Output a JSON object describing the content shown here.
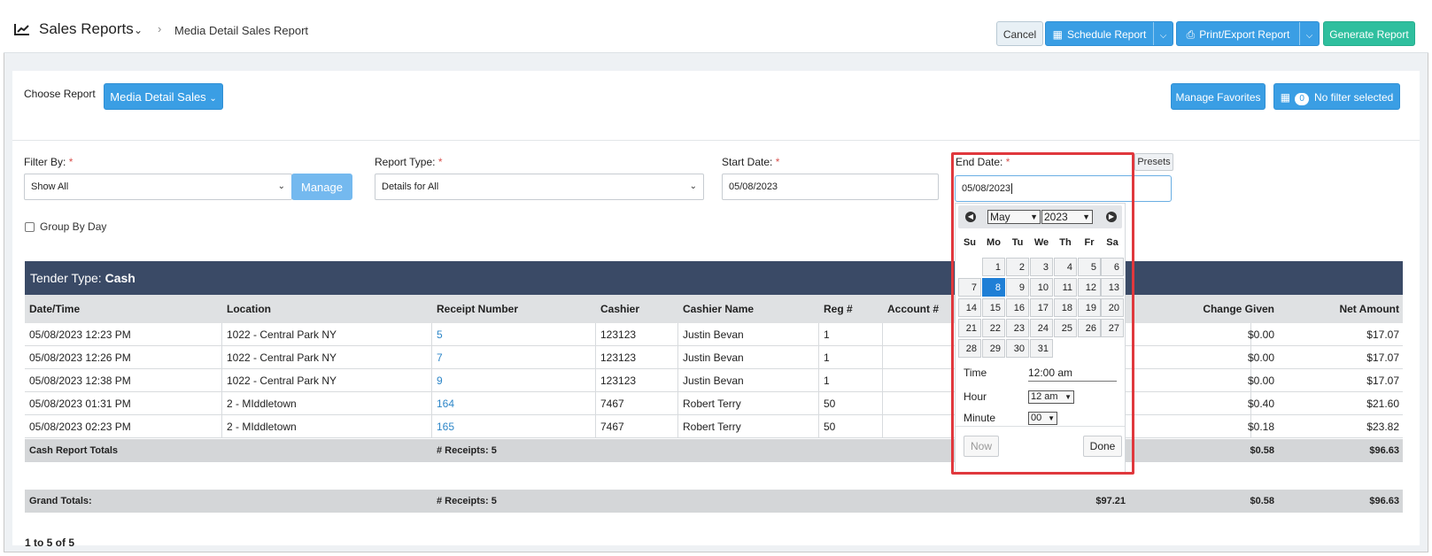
{
  "header": {
    "title": "Sales Reports",
    "breadcrumb": "Media Detail Sales Report",
    "cancel_label": "Cancel",
    "schedule_label": "Schedule Report",
    "print_label": "Print/Export Report",
    "generate_label": "Generate Report"
  },
  "report": {
    "choose_label": "Choose Report",
    "selected_report": "Media Detail Sales",
    "manage_favorites_label": "Manage Favorites",
    "filter_count": "0",
    "filter_status": "No filter selected"
  },
  "filters": {
    "filter_by_label": "Filter By:",
    "filter_by_value": "Show All",
    "manage_label": "Manage",
    "report_type_label": "Report Type:",
    "report_type_value": "Details for All",
    "start_date_label": "Start Date:",
    "start_date_value": "05/08/2023",
    "end_date_label": "End Date:",
    "end_date_value": "05/08/2023",
    "presets_label": "Presets",
    "required_marker": "*",
    "group_by_day_label": "Group By Day"
  },
  "table": {
    "tender_label": "Tender Type:",
    "tender_value": "Cash",
    "columns": {
      "datetime": "Date/Time",
      "location": "Location",
      "receipt": "Receipt Number",
      "cashier": "Cashier",
      "cashier_name": "Cashier Name",
      "reg": "Reg #",
      "account": "Account #",
      "change": "Change Given",
      "net": "Net Amount"
    },
    "rows": [
      {
        "datetime": "05/08/2023 12:23 PM",
        "location": "1022 - Central Park NY",
        "receipt": "5",
        "cashier": "123123",
        "cashier_name": "Justin Bevan",
        "reg": "1",
        "change": "$0.00",
        "net": "$17.07"
      },
      {
        "datetime": "05/08/2023 12:26 PM",
        "location": "1022 - Central Park NY",
        "receipt": "7",
        "cashier": "123123",
        "cashier_name": "Justin Bevan",
        "reg": "1",
        "change": "$0.00",
        "net": "$17.07"
      },
      {
        "datetime": "05/08/2023 12:38 PM",
        "location": "1022 - Central Park NY",
        "receipt": "9",
        "cashier": "123123",
        "cashier_name": "Justin Bevan",
        "reg": "1",
        "change": "$0.00",
        "net": "$17.07"
      },
      {
        "datetime": "05/08/2023 01:31 PM",
        "location": "2 - MIddletown",
        "receipt": "164",
        "cashier": "7467",
        "cashier_name": "Robert Terry",
        "reg": "50",
        "change": "$0.40",
        "net": "$21.60"
      },
      {
        "datetime": "05/08/2023 02:23 PM",
        "location": "2 - MIddletown",
        "receipt": "165",
        "cashier": "7467",
        "cashier_name": "Robert Terry",
        "reg": "50",
        "change": "$0.18",
        "net": "$23.82"
      }
    ],
    "cash_totals": {
      "label": "Cash Report Totals",
      "receipts": "# Receipts: 5",
      "change": "$0.58",
      "net": "$96.63"
    },
    "grand_totals": {
      "label": "Grand Totals:",
      "receipts": "# Receipts: 5",
      "amount": "$97.21",
      "change": "$0.58",
      "net": "$96.63"
    },
    "pager": "1 to 5 of 5"
  },
  "calendar": {
    "month": "May",
    "year": "2023",
    "weekdays": [
      "Su",
      "Mo",
      "Tu",
      "We",
      "Th",
      "Fr",
      "Sa"
    ],
    "days": [
      "1",
      "2",
      "3",
      "4",
      "5",
      "6",
      "7",
      "8",
      "9",
      "10",
      "11",
      "12",
      "13",
      "14",
      "15",
      "16",
      "17",
      "18",
      "19",
      "20",
      "21",
      "22",
      "23",
      "24",
      "25",
      "26",
      "27",
      "28",
      "29",
      "30",
      "31"
    ],
    "selected_day": "8",
    "time_label": "Time",
    "time_value": "12:00 am",
    "hour_label": "Hour",
    "hour_value": "12 am",
    "minute_label": "Minute",
    "minute_value": "00",
    "now_label": "Now",
    "done_label": "Done"
  },
  "colors": {
    "primary": "#3a9ee4",
    "accent_green": "#2fbf9e",
    "header_navy": "#3a4a66",
    "highlight_red": "#e0383d",
    "link": "#2d86c8"
  }
}
